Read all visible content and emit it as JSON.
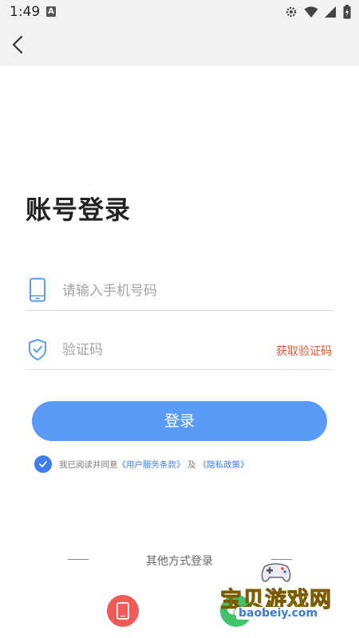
{
  "status_bar": {
    "time": "1:49",
    "notification_badge": "A",
    "icons": [
      "gear-icon",
      "wifi-icon",
      "signal-icon",
      "battery-icon"
    ]
  },
  "nav": {
    "back_icon": "chevron-left-icon"
  },
  "title": "账号登录",
  "phone_field": {
    "placeholder": "请输入手机号码",
    "value": "",
    "icon": "phone-icon"
  },
  "code_field": {
    "placeholder": "验证码",
    "value": "",
    "icon": "shield-check-icon",
    "get_code_label": "获取验证码"
  },
  "login_button": {
    "label": "登录"
  },
  "agreement": {
    "checked": true,
    "prefix": "我已阅读并同意",
    "terms_link": "《用户服务条款》",
    "connector": "及",
    "privacy_link": "《隐私政策》"
  },
  "other_login": {
    "label": "其他方式登录",
    "methods": [
      "phone-login-icon",
      "wechat-login-icon"
    ]
  },
  "watermark": {
    "text": "宝贝游戏网",
    "url": "baobeiy.com"
  },
  "colors": {
    "accent": "#5b9bf8",
    "link": "#3f7cf0",
    "get_code": "#e4572e",
    "phone_btn": "#f25a5a",
    "wechat_btn": "#3fc36b"
  }
}
